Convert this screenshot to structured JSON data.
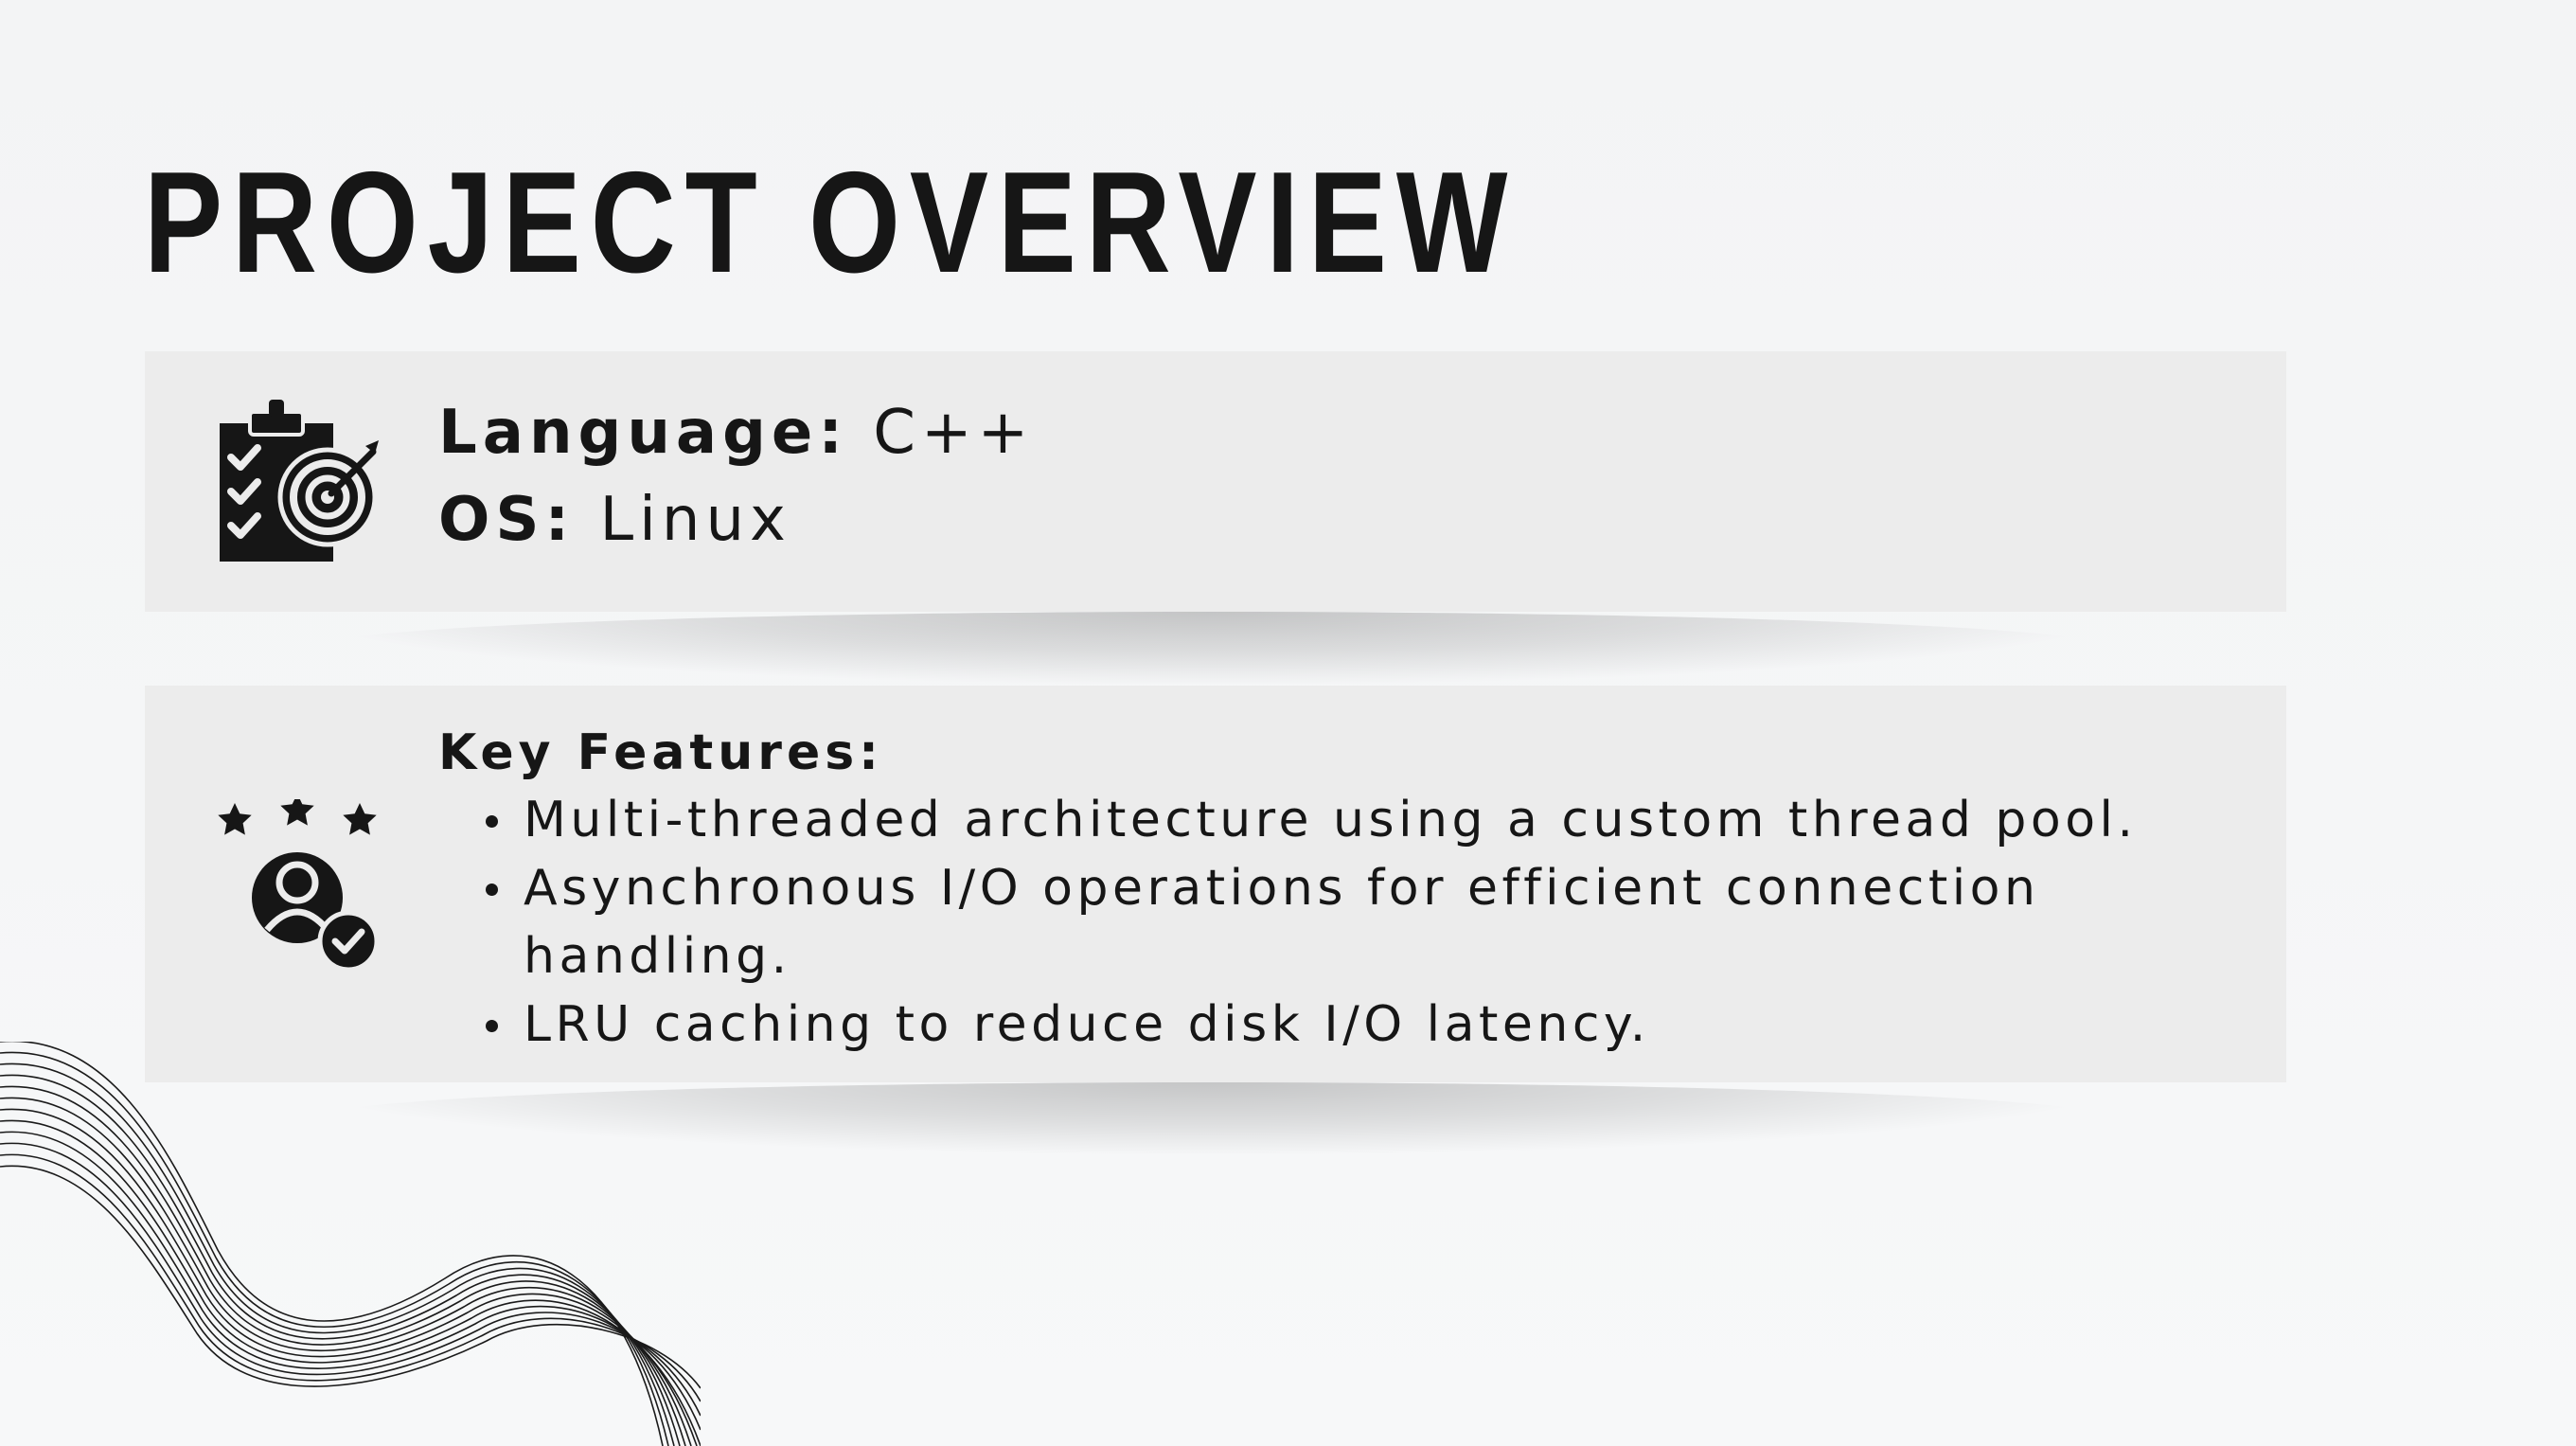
{
  "slide": {
    "title": "PROJECT OVERVIEW"
  },
  "overview": {
    "icon": "clipboard-target-icon",
    "language_label": "Language:",
    "language_value": "C++",
    "os_label": "OS:",
    "os_value": "Linux"
  },
  "features": {
    "icon": "user-rating-check-icon",
    "heading": "Key Features:",
    "items": [
      "Multi-threaded architecture using a custom thread pool.",
      "Asynchronous I/O operations for efficient connection handling.",
      "LRU caching to reduce disk I/O latency."
    ]
  },
  "colors": {
    "text": "#161616",
    "card_background": "#ececec",
    "page_background": "#f4f5f6"
  }
}
